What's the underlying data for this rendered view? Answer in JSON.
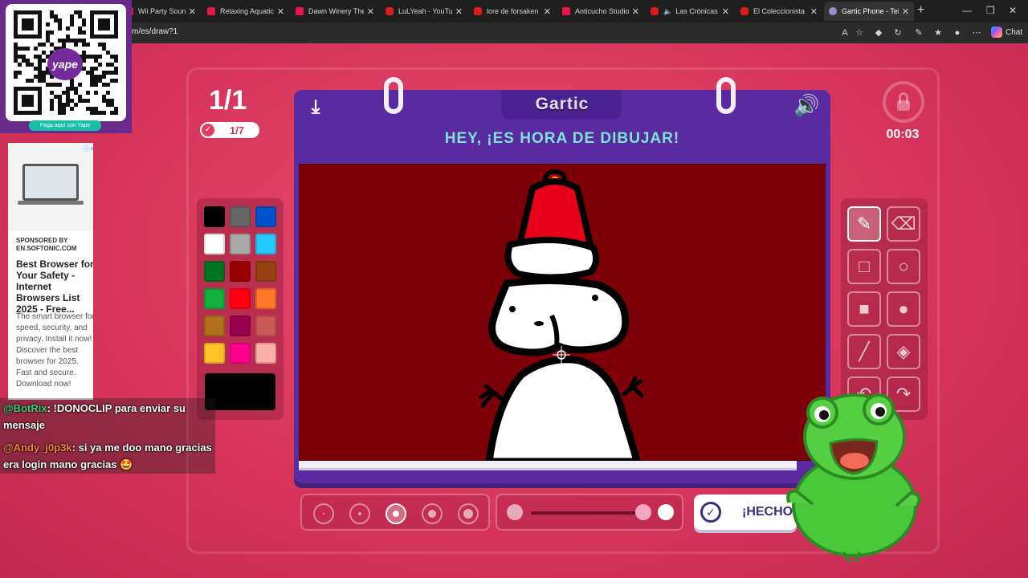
{
  "browser": {
    "tabs": [
      {
        "label": "Wii Party Soundtrack",
        "icon": "music-icon",
        "active": false
      },
      {
        "label": "Relaxing Aquatic Am",
        "icon": "music-icon",
        "active": false
      },
      {
        "label": "Dawn Winery Theme",
        "icon": "music-icon",
        "active": false
      },
      {
        "label": "LuLYeah - YouTube",
        "icon": "youtube-icon",
        "active": false
      },
      {
        "label": "lore de forsaken - Yo",
        "icon": "youtube-icon",
        "active": false
      },
      {
        "label": "Anticucho Studios -",
        "icon": "music-icon",
        "active": false
      },
      {
        "label": "Las Crónicas de",
        "icon": "youtube-icon",
        "active": false
      },
      {
        "label": "El Coleccionista De",
        "icon": "youtube-icon",
        "active": false
      },
      {
        "label": "Gartic Phone - Teléfo",
        "icon": "gartic-icon",
        "active": true
      }
    ],
    "url": "m/es/draw?1",
    "chat_button": "Chat"
  },
  "game": {
    "round": "1/1",
    "players": "1/7",
    "timer": "00:03",
    "brand": "Gartic",
    "headline": "HEY, ¡ES HORA DE DIBUJAR!",
    "done_label": "¡HECHO",
    "palette_colors": [
      "#000000",
      "#666666",
      "#0050cd",
      "#ffffff",
      "#aaaaaa",
      "#26c9ff",
      "#017420",
      "#990000",
      "#964112",
      "#11b03c",
      "#ff0013",
      "#ff7829",
      "#b0701c",
      "#99004e",
      "#cb5a57",
      "#ffc126",
      "#ff008f",
      "#feafa8"
    ],
    "current_color": "#000000",
    "tools": [
      "pencil-icon",
      "eraser-icon",
      "rect-outline-icon",
      "circle-outline-icon",
      "rect-fill-icon",
      "circle-fill-icon",
      "line-icon",
      "bucket-icon",
      "undo-icon",
      "redo-icon"
    ],
    "selected_tool": "pencil-icon",
    "brush_sizes": 5,
    "selected_size": 3
  },
  "overlay": {
    "qr_pay_label": "Paga aquí con Yape",
    "yape": "yape",
    "ad_sponsor": "SPONSORED BY EN.SOFTONIC.COM",
    "ad_title": "Best Browser for Your Safety - Internet Browsers List 2025 - Free...",
    "ad_body": "The smart browser for speed, security, and privacy. Install it now! Discover the best browser for 2025. Fast and secure. Download now!",
    "chat": [
      {
        "user": "@BotRix",
        "text": ": !DONOCLIP para enviar su mensaje"
      },
      {
        "user": "@Andy_j0p3k",
        "text": ": si ya me doo mano gracias era login mano gracias 🤩"
      }
    ]
  }
}
